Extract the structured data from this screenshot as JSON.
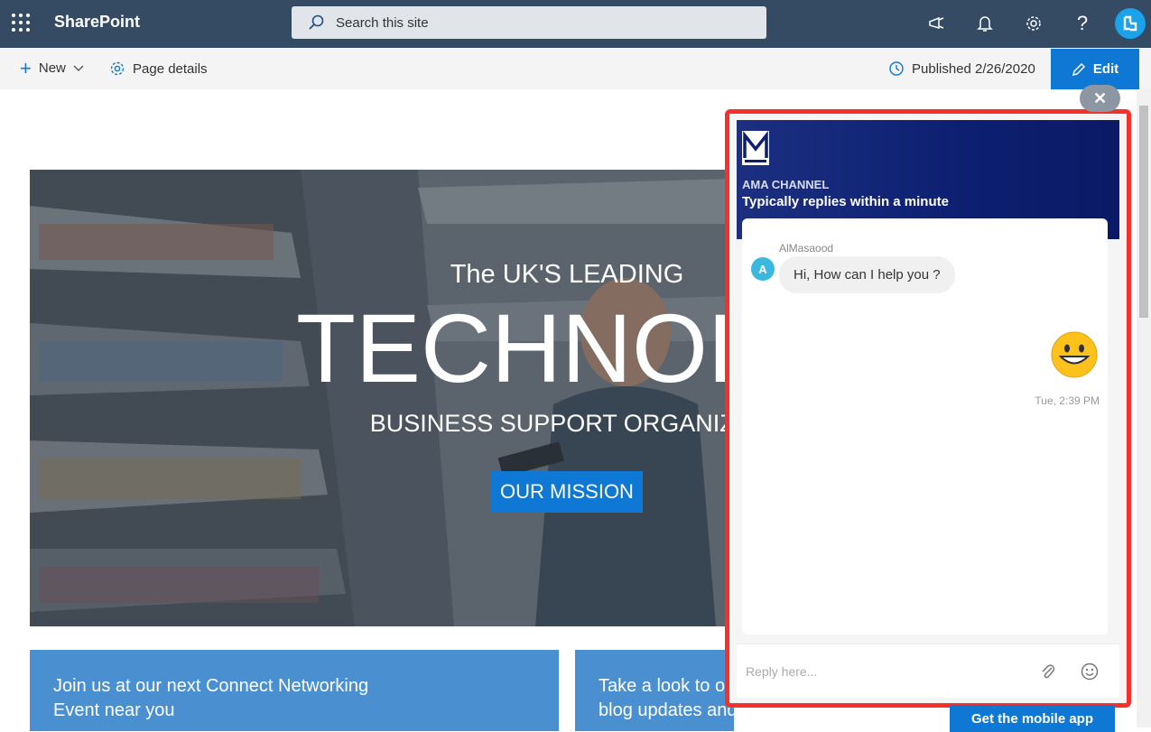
{
  "header": {
    "app_name": "SharePoint",
    "search_placeholder": "Search this site"
  },
  "commandbar": {
    "new_label": "New",
    "page_details_label": "Page details",
    "published_label": "Published 2/26/2020",
    "edit_label": "Edit"
  },
  "hero": {
    "line1": "The UK'S LEADING",
    "line2": "TECHNOLO",
    "line3": "BUSINESS SUPPORT ORGANIZAT",
    "button_label": "OUR MISSION"
  },
  "cards": [
    {
      "line1": "Join us at our next Connect Networking",
      "line2": "Event near you"
    },
    {
      "line1": "Take a look to o",
      "line2": "blog updates and helpful guides"
    }
  ],
  "chat": {
    "channel": "AMA CHANNEL",
    "tagline": "Typically replies within a minute",
    "sender_name": "AlMasaood",
    "sender_initial": "A",
    "message": "Hi, How can I help you ?",
    "timestamp": "Tue, 2:39 PM",
    "reply_placeholder": "Reply here...",
    "close_label": "✕",
    "mobile_app_label": "Get the mobile app"
  },
  "colors": {
    "suitebar": "#344b63",
    "accent": "#0f78d4",
    "chat_header": "#0c1f70",
    "highlight_border": "#f4312a"
  },
  "icons": [
    "waffle-icon",
    "search-icon",
    "megaphone-icon",
    "bell-icon",
    "gear-icon",
    "help-icon",
    "avatar",
    "plus-icon",
    "chevron-down-icon",
    "history-icon",
    "pencil-icon",
    "paperclip-icon",
    "smiley-icon",
    "close-icon"
  ]
}
